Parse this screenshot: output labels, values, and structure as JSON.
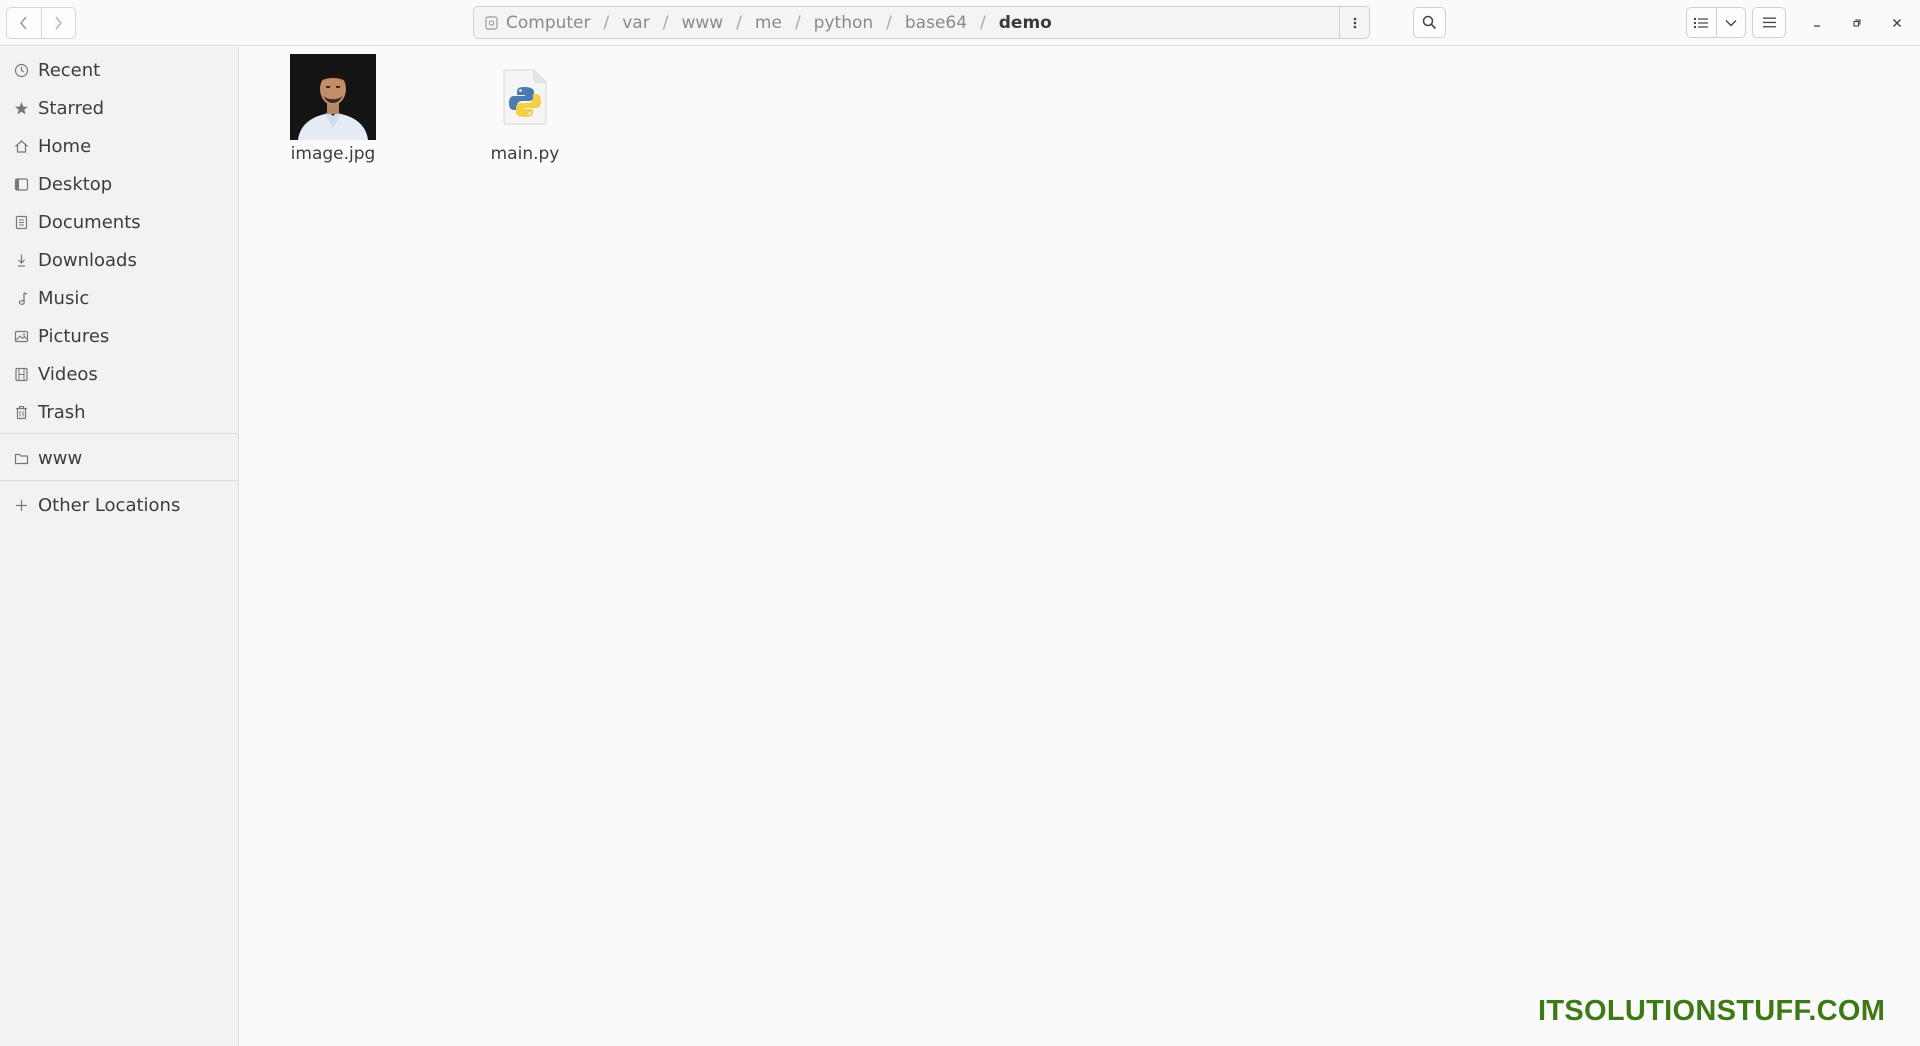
{
  "header": {
    "back_icon": "chevron-left-icon",
    "forward_icon": "chevron-right-icon",
    "path": {
      "root_icon": "drive-icon",
      "segments": [
        "Computer",
        "var",
        "www",
        "me",
        "python",
        "base64"
      ],
      "current": "demo",
      "separator": "/"
    },
    "path_menu_icon": "vertical-dots-icon",
    "search_icon": "search-icon",
    "view_list_icon": "list-view-icon",
    "view_dropdown_icon": "chevron-down-icon",
    "main_menu_icon": "hamburger-menu-icon",
    "window_controls": [
      "minimize-icon",
      "restore-icon",
      "close-icon"
    ]
  },
  "sidebar": {
    "items": [
      {
        "label": "Recent",
        "icon": "clock-icon"
      },
      {
        "label": "Starred",
        "icon": "star-icon"
      },
      {
        "label": "Home",
        "icon": "home-icon"
      },
      {
        "label": "Desktop",
        "icon": "desktop-icon"
      },
      {
        "label": "Documents",
        "icon": "document-icon"
      },
      {
        "label": "Downloads",
        "icon": "download-icon"
      },
      {
        "label": "Music",
        "icon": "music-note-icon"
      },
      {
        "label": "Pictures",
        "icon": "picture-icon"
      },
      {
        "label": "Videos",
        "icon": "film-icon"
      },
      {
        "label": "Trash",
        "icon": "trash-icon"
      }
    ],
    "bookmarks": [
      {
        "label": "www",
        "icon": "folder-icon"
      }
    ],
    "other_locations": {
      "label": "Other Locations",
      "icon": "plus-icon"
    }
  },
  "files": [
    {
      "name": "image.jpg",
      "icon": "image-thumbnail"
    },
    {
      "name": "main.py",
      "icon": "python-file-icon"
    }
  ],
  "watermark": "ITSOLUTIONSTUFF.COM",
  "colors": {
    "watermark": "#3d7a16",
    "background": "#fafafa",
    "sidebar": "#f2f2f2"
  }
}
